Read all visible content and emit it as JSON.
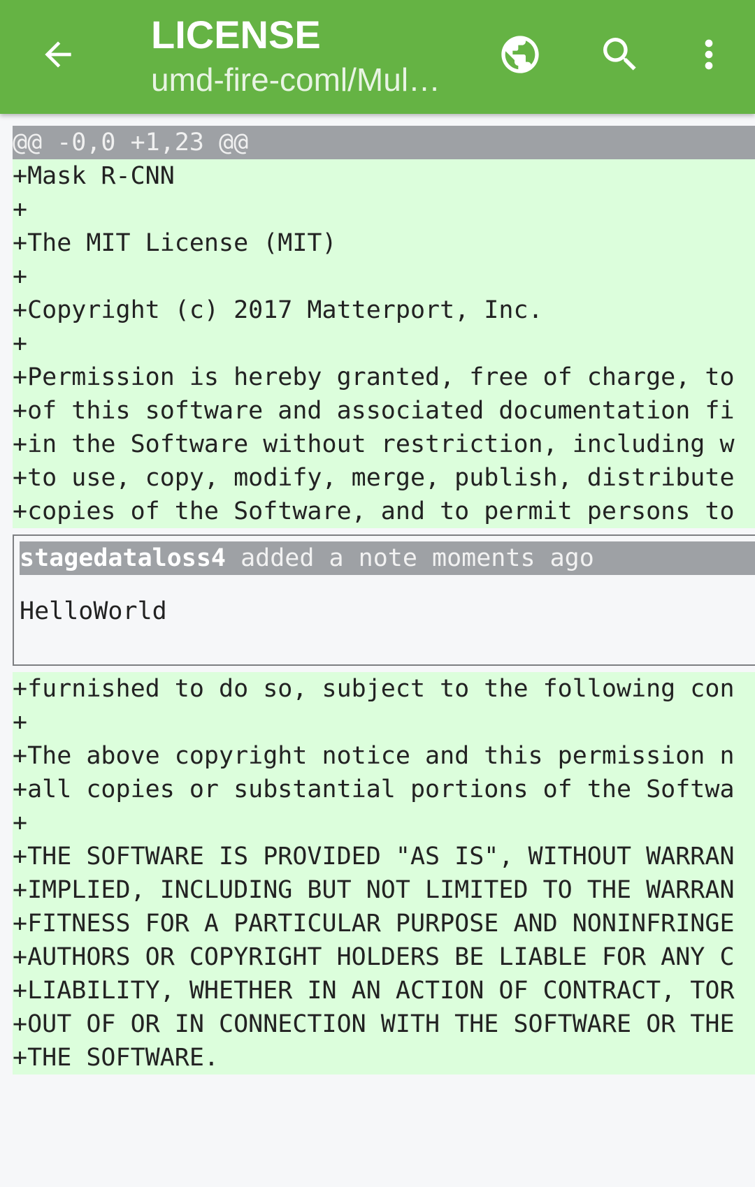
{
  "appbar": {
    "title": "LICENSE",
    "subtitle": "umd-fire-coml/Mul…",
    "icons": [
      "back-arrow-icon",
      "globe-icon",
      "search-icon",
      "more-vert-icon"
    ],
    "color": "#65b344"
  },
  "diff": {
    "hunk_header": "@@ -0,0 +1,23 @@",
    "lines_before_note": [
      "+Mask R-CNN",
      "+",
      "+The MIT License (MIT)",
      "+",
      "+Copyright (c) 2017 Matterport, Inc.",
      "+",
      "+Permission is hereby granted, free of charge, to",
      "+of this software and associated documentation fi",
      "+in the Software without restriction, including w",
      "+to use, copy, modify, merge, publish, distribute",
      "+copies of the Software, and to permit persons to"
    ],
    "note": {
      "author": "stagedataloss4",
      "action": " added a note moments ago",
      "body": "HelloWorld"
    },
    "lines_after_note": [
      "+furnished to do so, subject to the following con",
      "+",
      "+The above copyright notice and this permission n",
      "+all copies or substantial portions of the Softwa",
      "+",
      "+THE SOFTWARE IS PROVIDED \"AS IS\", WITHOUT WARRAN",
      "+IMPLIED, INCLUDING BUT NOT LIMITED TO THE WARRAN",
      "+FITNESS FOR A PARTICULAR PURPOSE AND NONINFRINGE",
      "+AUTHORS OR COPYRIGHT HOLDERS BE LIABLE FOR ANY C",
      "+LIABILITY, WHETHER IN AN ACTION OF CONTRACT, TOR",
      "+OUT OF OR IN CONNECTION WITH THE SOFTWARE OR THE",
      "+THE SOFTWARE."
    ],
    "colors": {
      "added_bg": "#dcfedc",
      "hunk_bg": "#9ea1a5"
    }
  }
}
